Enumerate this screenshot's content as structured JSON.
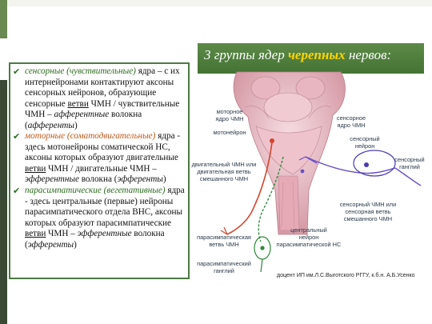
{
  "slide": {
    "title_prefix": "3 группы ядер ",
    "title_accent": "черепных",
    "title_suffix": " нервов:",
    "credit": "доцент ИП им.Л.С.Выготского РГГУ, к.б.н. А.Б.Усенко"
  },
  "groups": [
    {
      "name": "сенсорные (чувствительные)",
      "t1": " ядра – с их интернейронами контактируют аксоны сенсорных нейронов, образующие сенсорные ",
      "link": "ветви",
      "t2": " ЧМН / чувствительные ЧМН – ",
      "emph": "афферентные",
      "t3": " волокна (",
      "emph2": "афференты",
      "t4": ")"
    },
    {
      "name": "моторные (соматодвигательные)",
      "t1": " ядра - здесь мотонейроны соматической НС, аксоны которых образуют двигательные ",
      "link": "ветви",
      "t2": " ЧМН / двигательные ЧМН – ",
      "emph": "эфферентные",
      "t3": " волокна (",
      "emph2": "эфференты",
      "t4": ")"
    },
    {
      "name": "парасимпатические (вегетативные)",
      "t1": " ядра - здесь центральные (первые) нейроны парасимпатического отдела ВНС, аксоны которых образуют парасимпатические ",
      "link": "ветви",
      "t2": " ЧМН – ",
      "emph": "эфферентные",
      "t3": " волокна (",
      "emph2": "эфференты",
      "t4": ")"
    }
  ],
  "diagram": {
    "labels": {
      "motor_nucleus": "моторное\nядро ЧМН",
      "motoneuron": "мотонейрон",
      "sensory_nucleus": "сенсорное\nядро ЧМН",
      "sensory_neuron": "сенсорный\nнейрон",
      "sensory_ganglion": "сенсорный\nганглий",
      "motor_branch": "двигательный ЧМН или\nдвигательная ветвь\nсмешанного ЧМН",
      "sensory_branch": "сенсорный ЧМН или\nсенсорная ветвь\nсмешанного ЧМН",
      "central_neuron": "центральный\nнейрон\nпарасимпатической НС",
      "parasym_branch": "парасимпатическая\nветвь ЧМН",
      "parasym_ganglion": "парасимпатический\nганглий"
    },
    "colors": {
      "motor": "#d4462e",
      "sensory": "#6a4fc8",
      "parasym": "#2f8a3a",
      "tissue": "#e8b9c2"
    }
  }
}
